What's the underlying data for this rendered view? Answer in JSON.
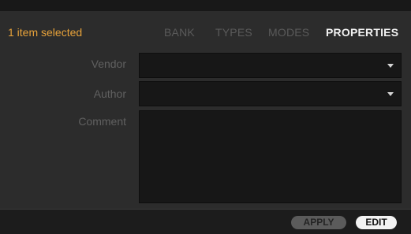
{
  "header": {
    "selection_status": "1 item selected",
    "tabs": [
      {
        "label": "BANK",
        "active": false
      },
      {
        "label": "TYPES",
        "active": false
      },
      {
        "label": "MODES",
        "active": false
      },
      {
        "label": "PROPERTIES",
        "active": true
      }
    ]
  },
  "form": {
    "vendor": {
      "label": "Vendor",
      "value": ""
    },
    "author": {
      "label": "Author",
      "value": ""
    },
    "comment": {
      "label": "Comment",
      "value": ""
    }
  },
  "footer": {
    "apply_label": "APPLY",
    "edit_label": "EDIT"
  },
  "colors": {
    "accent": "#e7a23a",
    "active_tab": "#f2f2f2",
    "inactive_tab": "#5a5a5a",
    "background": "#2c2c2c",
    "field": "#171717"
  }
}
